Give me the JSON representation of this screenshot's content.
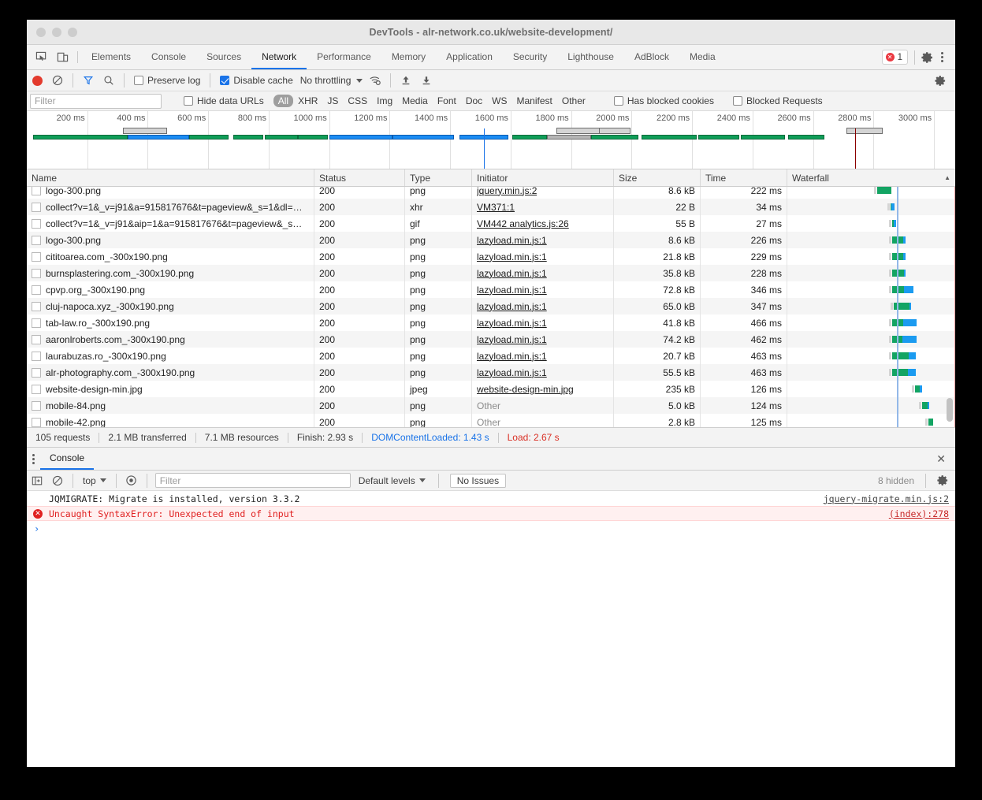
{
  "window": {
    "title": "DevTools - alr-network.co.uk/website-development/"
  },
  "main_tabs": {
    "items": [
      {
        "label": "Elements",
        "active": false
      },
      {
        "label": "Console",
        "active": false
      },
      {
        "label": "Sources",
        "active": false
      },
      {
        "label": "Network",
        "active": true
      },
      {
        "label": "Performance",
        "active": false
      },
      {
        "label": "Memory",
        "active": false
      },
      {
        "label": "Application",
        "active": false
      },
      {
        "label": "Security",
        "active": false
      },
      {
        "label": "Lighthouse",
        "active": false
      },
      {
        "label": "AdBlock",
        "active": false
      },
      {
        "label": "Media",
        "active": false
      }
    ],
    "error_count": "1"
  },
  "network_toolbar": {
    "preserve_log_label": "Preserve log",
    "preserve_log_checked": false,
    "disable_cache_label": "Disable cache",
    "disable_cache_checked": true,
    "throttling_value": "No throttling"
  },
  "filter_bar": {
    "filter_placeholder": "Filter",
    "filter_value": "",
    "hide_data_urls_label": "Hide data URLs",
    "hide_data_urls_checked": false,
    "types": [
      {
        "label": "All",
        "selected": true
      },
      {
        "label": "XHR",
        "selected": false
      },
      {
        "label": "JS",
        "selected": false
      },
      {
        "label": "CSS",
        "selected": false
      },
      {
        "label": "Img",
        "selected": false
      },
      {
        "label": "Media",
        "selected": false
      },
      {
        "label": "Font",
        "selected": false
      },
      {
        "label": "Doc",
        "selected": false
      },
      {
        "label": "WS",
        "selected": false
      },
      {
        "label": "Manifest",
        "selected": false
      },
      {
        "label": "Other",
        "selected": false
      }
    ],
    "has_blocked_cookies_label": "Has blocked cookies",
    "has_blocked_cookies_checked": false,
    "blocked_requests_label": "Blocked Requests",
    "blocked_requests_checked": false
  },
  "overview": {
    "ticks": [
      "200 ms",
      "400 ms",
      "600 ms",
      "800 ms",
      "1000 ms",
      "1200 ms",
      "1400 ms",
      "1600 ms",
      "1800 ms",
      "2000 ms",
      "2200 ms",
      "2400 ms",
      "2600 ms",
      "2800 ms",
      "3000 ms"
    ],
    "dom_content_loaded_marker_color": "#1a73e8",
    "load_marker_color": "#8b0000"
  },
  "table": {
    "columns": [
      {
        "label": "Name"
      },
      {
        "label": "Status"
      },
      {
        "label": "Type"
      },
      {
        "label": "Initiator"
      },
      {
        "label": "Size"
      },
      {
        "label": "Time"
      },
      {
        "label": "Waterfall"
      }
    ],
    "rows": [
      {
        "name": "logo-300.png",
        "status": "200",
        "type": "png",
        "initiator": "jquery.min.js:2",
        "initiator_link": true,
        "size": "8.6 kB",
        "time": "222 ms",
        "wf_start": 114,
        "wf_green": 18,
        "wf_blue": 0,
        "clipped": true
      },
      {
        "name": "collect?v=1&_v=j91&a=915817676&t=pageview&_s=1&dl=…",
        "status": "200",
        "type": "xhr",
        "initiator": "VM371:1",
        "initiator_link": true,
        "size": "22 B",
        "time": "34 ms",
        "wf_start": 131,
        "wf_green": 1,
        "wf_blue": 4
      },
      {
        "name": "collect?v=1&_v=j91&aip=1&a=915817676&t=pageview&_s…",
        "status": "200",
        "type": "gif",
        "initiator": "VM442 analytics.js:26",
        "initiator_link": true,
        "size": "55 B",
        "time": "27 ms",
        "wf_start": 133,
        "wf_green": 2,
        "wf_blue": 3
      },
      {
        "name": "logo-300.png",
        "status": "200",
        "type": "png",
        "initiator": "lazyload.min.js:1",
        "initiator_link": true,
        "size": "8.6 kB",
        "time": "226 ms",
        "wf_start": 133,
        "wf_green": 14,
        "wf_blue": 3
      },
      {
        "name": "cititoarea.com_-300x190.png",
        "status": "200",
        "type": "png",
        "initiator": "lazyload.min.js:1",
        "initiator_link": true,
        "size": "21.8 kB",
        "time": "229 ms",
        "wf_start": 133,
        "wf_green": 14,
        "wf_blue": 3
      },
      {
        "name": "burnsplastering.com_-300x190.png",
        "status": "200",
        "type": "png",
        "initiator": "lazyload.min.js:1",
        "initiator_link": true,
        "size": "35.8 kB",
        "time": "228 ms",
        "wf_start": 133,
        "wf_green": 15,
        "wf_blue": 2
      },
      {
        "name": "cpvp.org_-300x190.png",
        "status": "200",
        "type": "png",
        "initiator": "lazyload.min.js:1",
        "initiator_link": true,
        "size": "72.8 kB",
        "time": "346 ms",
        "wf_start": 133,
        "wf_green": 15,
        "wf_blue": 12
      },
      {
        "name": "cluj-napoca.xyz_-300x190.png",
        "status": "200",
        "type": "png",
        "initiator": "lazyload.min.js:1",
        "initiator_link": true,
        "size": "65.0 kB",
        "time": "347 ms",
        "wf_start": 135,
        "wf_green": 20,
        "wf_blue": 2
      },
      {
        "name": "tab-law.ro_-300x190.png",
        "status": "200",
        "type": "png",
        "initiator": "lazyload.min.js:1",
        "initiator_link": true,
        "size": "41.8 kB",
        "time": "466 ms",
        "wf_start": 133,
        "wf_green": 14,
        "wf_blue": 17
      },
      {
        "name": "aaronlroberts.com_-300x190.png",
        "status": "200",
        "type": "png",
        "initiator": "lazyload.min.js:1",
        "initiator_link": true,
        "size": "74.2 kB",
        "time": "462 ms",
        "wf_start": 133,
        "wf_green": 13,
        "wf_blue": 18
      },
      {
        "name": "laurabuzas.ro_-300x190.png",
        "status": "200",
        "type": "png",
        "initiator": "lazyload.min.js:1",
        "initiator_link": true,
        "size": "20.7 kB",
        "time": "463 ms",
        "wf_start": 133,
        "wf_green": 21,
        "wf_blue": 9
      },
      {
        "name": "alr-photography.com_-300x190.png",
        "status": "200",
        "type": "png",
        "initiator": "lazyload.min.js:1",
        "initiator_link": true,
        "size": "55.5 kB",
        "time": "463 ms",
        "wf_start": 133,
        "wf_green": 20,
        "wf_blue": 10
      },
      {
        "name": "website-design-min.jpg",
        "status": "200",
        "type": "jpeg",
        "initiator": "website-design-min.jpg",
        "initiator_link": true,
        "size": "235 kB",
        "time": "126 ms",
        "wf_start": 162,
        "wf_green": 6,
        "wf_blue": 3
      },
      {
        "name": "mobile-84.png",
        "status": "200",
        "type": "png",
        "initiator": "Other",
        "initiator_link": false,
        "size": "5.0 kB",
        "time": "124 ms",
        "wf_start": 171,
        "wf_green": 7,
        "wf_blue": 2
      },
      {
        "name": "mobile-42.png",
        "status": "200",
        "type": "png",
        "initiator": "Other",
        "initiator_link": false,
        "size": "2.8 kB",
        "time": "125 ms",
        "wf_start": 179,
        "wf_green": 6,
        "wf_blue": 0
      }
    ]
  },
  "summary": {
    "requests": "105 requests",
    "transferred": "2.1 MB transferred",
    "resources": "7.1 MB resources",
    "finish": "Finish: 2.93 s",
    "dom_content_loaded": "DOMContentLoaded: 1.43 s",
    "load": "Load: 2.67 s"
  },
  "drawer": {
    "tab_label": "Console",
    "context_value": "top",
    "filter_placeholder": "Filter",
    "filter_value": "",
    "levels_label": "Default levels",
    "issues_label": "No Issues",
    "hidden_label": "8 hidden",
    "messages": [
      {
        "text": "JQMIGRATE: Migrate is installed, version 3.3.2",
        "source": "jquery-migrate.min.js:2",
        "level": "log"
      },
      {
        "text": "Uncaught SyntaxError: Unexpected end of input",
        "source": "(index):278",
        "level": "error"
      }
    ],
    "prompt": "›"
  }
}
